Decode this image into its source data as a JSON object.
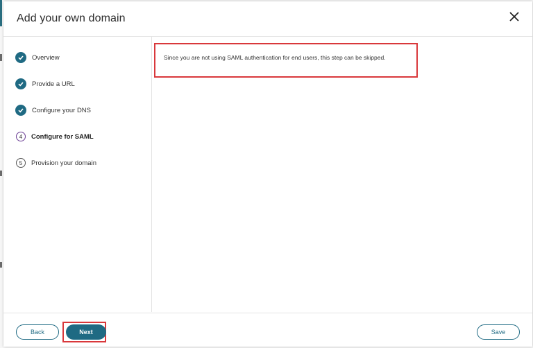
{
  "dialog": {
    "title": "Add your own domain"
  },
  "steps": [
    {
      "label": "Overview",
      "status": "complete"
    },
    {
      "label": "Provide a URL",
      "status": "complete"
    },
    {
      "label": "Configure your DNS",
      "status": "complete"
    },
    {
      "label": "Configure for SAML",
      "status": "current",
      "number": "4"
    },
    {
      "label": "Provision your domain",
      "status": "pending",
      "number": "5"
    }
  ],
  "content": {
    "message": "Since you are not using SAML authentication for end users, this step can be skipped."
  },
  "footer": {
    "back_label": "Back",
    "next_label": "Next",
    "save_label": "Save"
  },
  "colors": {
    "accent": "#1f6a83",
    "highlight": "#d9383b"
  },
  "icons": {
    "close": "close-icon",
    "complete": "check-circle-icon"
  }
}
